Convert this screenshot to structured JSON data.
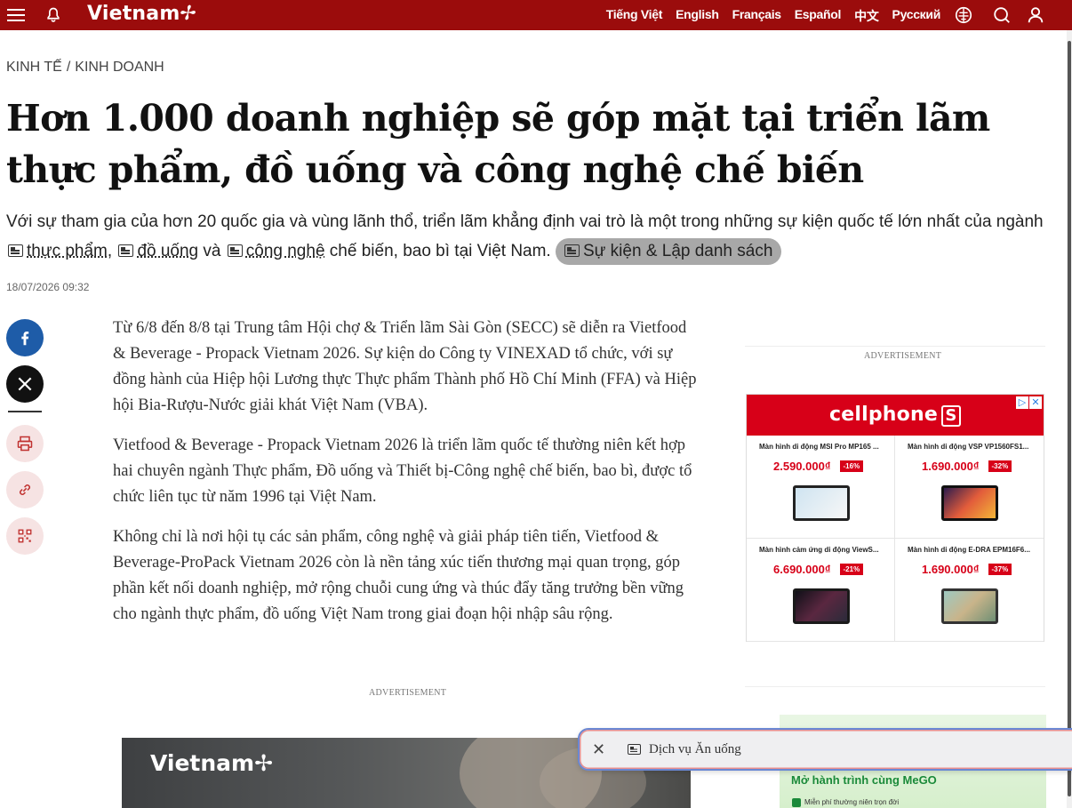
{
  "header": {
    "logo": "Vietnam",
    "languages": [
      "Tiếng Việt",
      "English",
      "Français",
      "Español",
      "中文",
      "Русский"
    ],
    "icons": [
      "menu-icon",
      "bell-icon",
      "globe-icon",
      "search-icon",
      "user-icon"
    ],
    "color": "#9b0c0c"
  },
  "breadcrumb": {
    "parent": "KINH TẾ",
    "separator": "/",
    "child": "KINH DOANH"
  },
  "article": {
    "title": "Hơn 1.000 doanh nghiệp sẽ góp mặt tại triển lãm thực phẩm, đồ uống và công nghệ chế biến",
    "sapo": {
      "part1": "Với sự tham gia của hơn 20 quốc gia và vùng lãnh thổ, triển lãm khẳng định vai trò là một trong những sự kiện quốc tế lớn nhất của ngành",
      "kw1": "thực phẩm",
      "sep1": ",",
      "kw2": "đồ uống",
      "sep2": "và",
      "kw3": "công nghệ",
      "part2": "chế biến, bao bì tại Việt Nam.",
      "event_pill": "Sự kiện & Lập danh sách"
    },
    "date": "18/07/2026 09:32",
    "paragraphs": [
      "Từ 6/8 đến 8/8 tại Trung tâm Hội chợ & Triển lãm Sài Gòn (SECC) sẽ diễn ra Vietfood & Beverage - Propack Vietnam 2026. Sự kiện do Công ty VINEXAD tổ chức, với sự đồng hành của Hiệp hội Lương thực Thực phẩm Thành phố Hồ Chí Minh (FFA) và Hiệp hội Bia-Rượu-Nước giải khát Việt Nam (VBA).",
      "Vietfood & Beverage - Propack Vietnam 2026 là triển lãm quốc tế thường niên kết hợp hai chuyên ngành Thực phẩm, Đồ uống và Thiết bị-Công nghệ chế biến, bao bì, được tổ chức liên tục từ năm 1996 tại Việt Nam.",
      "Không chỉ là nơi hội tụ các sản phẩm, công nghệ và giải pháp tiên tiến, Vietfood & Beverage-ProPack Vietnam 2026 còn là nền tảng xúc tiến thương mại quan trọng, góp phần kết nối doanh nghiệp, mở rộng chuỗi cung ứng và thúc đẩy tăng trưởng bền vững cho ngành thực phẩm, đồ uống Việt Nam trong giai đoạn hội nhập sâu rộng."
    ],
    "advertisement_label": "ADVERTISEMENT",
    "video_logo": "Vietnam"
  },
  "share": [
    "facebook-icon",
    "x-icon",
    "print-icon",
    "link-icon",
    "qr-icon"
  ],
  "sidebar_ad": {
    "label": "ADVERTISEMENT",
    "brand": "cellphone",
    "brand_s": "S",
    "products": [
      {
        "name": "Màn hình di động MSI Pro MP165 ...",
        "price": "2.590.000₫",
        "discount": "-16%"
      },
      {
        "name": "Màn hình di động VSP VP1560FS1...",
        "price": "1.690.000₫",
        "discount": "-32%"
      },
      {
        "name": "Màn hình cảm ứng di động ViewS...",
        "price": "6.690.000₫",
        "discount": "-21%"
      },
      {
        "name": "Màn hình di động E-DRA EPM16F6...",
        "price": "1.690.000₫",
        "discount": "-37%"
      }
    ],
    "brand_color": "#d70018"
  },
  "mego_ad": {
    "title": "Mở hành trình cùng MeGO",
    "subtitle": "Miễn phí thường niên trọn đời"
  },
  "floating_chip": {
    "label": "Dịch vụ Ăn uống"
  }
}
